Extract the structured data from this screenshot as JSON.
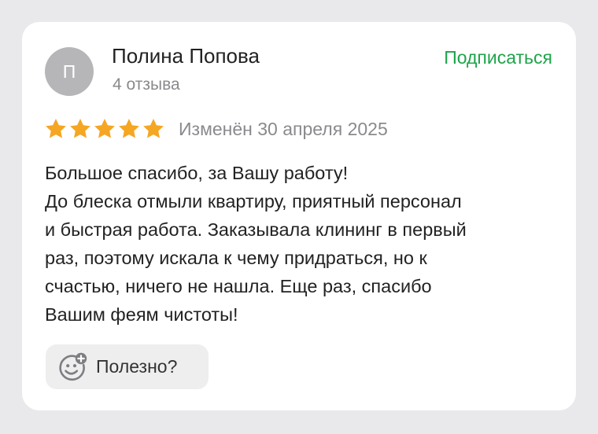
{
  "review": {
    "author": {
      "initial": "П",
      "name": "Полина Попова",
      "reviews_count": "4 отзыва"
    },
    "subscribe_label": "Подписаться",
    "rating": {
      "stars": 5,
      "max": 5
    },
    "edited_label": "Изменён 30 апреля 2025",
    "text_lines": [
      "Большое спасибо, за Вашу работу!",
      "До блеска отмыли квартиру, приятный персонал",
      "и быстрая работа. Заказывала клининг в первый",
      "раз, поэтому искала к чему придраться, но к",
      "счастью, ничего не нашла. Еще раз, спасибо",
      "Вашим феям чистоты!"
    ],
    "helpful_label": "Полезно?",
    "helpful_icon": "smile-plus-icon"
  },
  "colors": {
    "accent_green": "#1ea44a",
    "star_gold": "#f5a623",
    "avatar_bg": "#b6b6b9",
    "page_bg": "#e9e9ec"
  }
}
